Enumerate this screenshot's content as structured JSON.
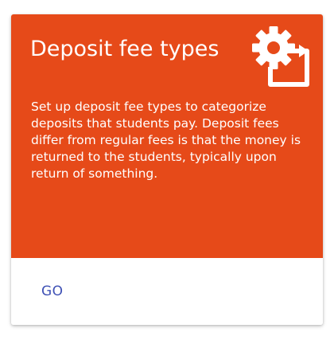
{
  "card": {
    "title": "Deposit fee types",
    "description": "Set up deposit fee types to categorize deposits that students pay. Deposit fees differ from regular fees is that the money is returned to the students, typically upon return of something.",
    "icon": "settings-applications-icon",
    "action_label": "GO"
  },
  "colors": {
    "header_background": "#e64a19",
    "header_text": "#ffffff",
    "action_text": "#3f51b5"
  }
}
